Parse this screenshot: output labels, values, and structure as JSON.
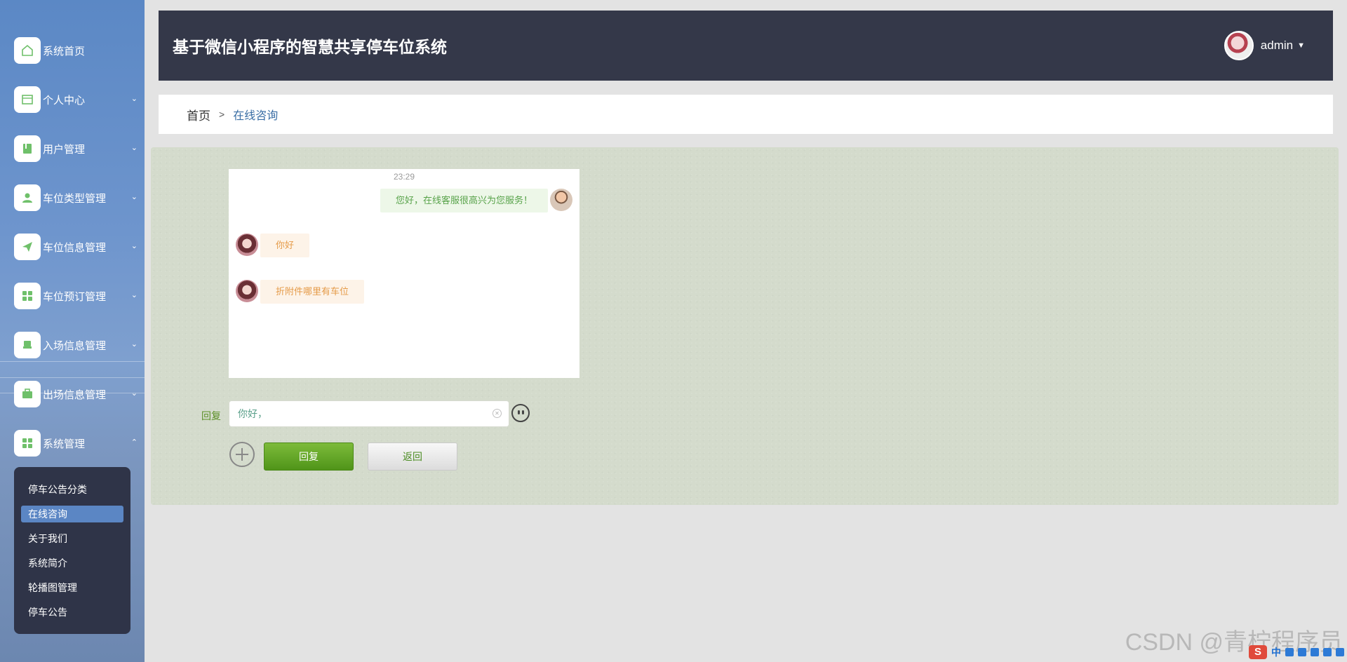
{
  "header": {
    "title": "基于微信小程序的智慧共享停车位系统",
    "username": "admin"
  },
  "sidebar": {
    "items": [
      {
        "label": "系统首页",
        "icon": "home-icon"
      },
      {
        "label": "个人中心",
        "icon": "calendar-icon"
      },
      {
        "label": "用户管理",
        "icon": "book-icon"
      },
      {
        "label": "车位类型管理",
        "icon": "user-icon"
      },
      {
        "label": "车位信息管理",
        "icon": "paper-plane-icon"
      },
      {
        "label": "车位预订管理",
        "icon": "grid-icon"
      },
      {
        "label": "入场信息管理",
        "icon": "chair-icon"
      },
      {
        "label": "出场信息管理",
        "icon": "briefcase-icon"
      },
      {
        "label": "系统管理",
        "icon": "grid-icon"
      }
    ],
    "submenu": [
      {
        "label": "停车公告分类"
      },
      {
        "label": "在线咨询",
        "active": true
      },
      {
        "label": "关于我们"
      },
      {
        "label": "系统简介"
      },
      {
        "label": "轮播图管理"
      },
      {
        "label": "停车公告"
      }
    ]
  },
  "breadcrumb": {
    "home": "首页",
    "separator": ">",
    "current": "在线咨询"
  },
  "chat": {
    "time": "23:29",
    "messages": [
      {
        "from": "admin",
        "text": "您好，在线客服很高兴为您服务！"
      },
      {
        "from": "user",
        "text": "你好"
      },
      {
        "from": "user",
        "text": "折附件哪里有车位"
      }
    ]
  },
  "reply": {
    "label": "回复",
    "value": "你好，",
    "reply_button": "回复",
    "back_button": "返回"
  },
  "watermark": "CSDN @青柠程序员",
  "tray": {
    "logo": "S",
    "text": "中"
  },
  "colors": {
    "sidebar": "#6a91ca",
    "header": "#343849",
    "submenu_bg": "#2f3448",
    "active_item": "#5b86c4",
    "reply_button": "#5f9e22",
    "panel_bg": "#d4dbcc"
  }
}
